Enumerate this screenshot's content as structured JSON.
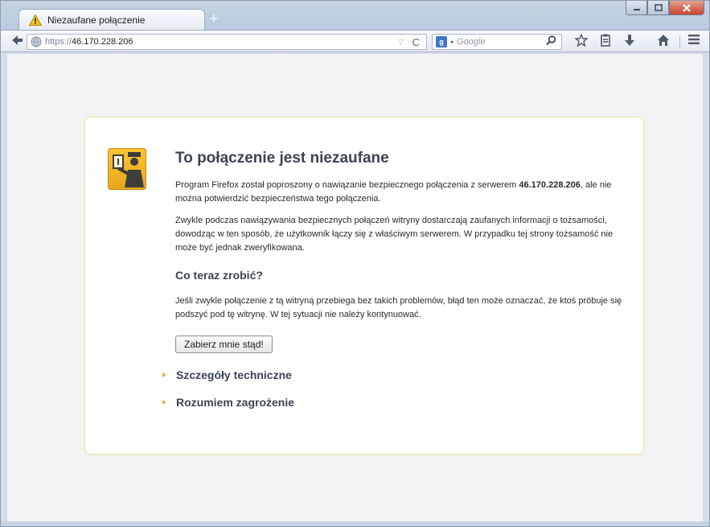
{
  "browser": {
    "tab_title": "Niezaufane połączenie",
    "new_tab_symbol": "+",
    "url_protocol": "https://",
    "url_host": "46.170.228.206",
    "search_placeholder": "Google",
    "window_controls": [
      "minimize",
      "maximize",
      "close"
    ]
  },
  "icons": {
    "tab": "warning-icon",
    "back": "back-arrow-icon",
    "site": "globe-icon",
    "reload": "reload-icon",
    "search_engine": "google-icon",
    "search_go": "magnifier-icon",
    "bookmark": "star-icon",
    "library": "clipboard-icon",
    "downloads": "download-arrow-icon",
    "home": "home-icon",
    "menu": "hamburger-menu-icon",
    "page": "certificate-officer-icon"
  },
  "error_page": {
    "title": "To połączenie jest niezaufane",
    "intro_prefix": "Program Firefox został poproszony o nawiązanie bezpiecznego połączenia z serwerem ",
    "intro_host": "46.170.228.206",
    "intro_suffix": ", ale nie można potwierdzić bezpieczeństwa tego połączenia.",
    "explanation": "Zwykle podczas nawiązywania bezpiecznych połączeń witryny dostarczają zaufanych informacji o tożsamości, dowodząc w ten sposób, że użytkownik łączy się z właściwym serwerem. W przypadku tej strony tożsamość nie może być jednak zweryfikowana.",
    "what_to_do_title": "Co teraz zrobić?",
    "what_to_do_text": "Jeśli zwykle połączenie z tą witryną przebiega bez takich problemów, błąd ten może oznaczać, że ktoś próbuje się podszyć pod tę witrynę. W tej sytuacji nie należy kontynuować.",
    "get_me_out_button": "Zabierz mnie stąd!",
    "technical_details": "Szczegóły techniczne",
    "understand_risks": "Rozumiem zagrożenie"
  },
  "colors": {
    "card_border": "#f0e3a0",
    "heading": "#3b4451",
    "expander_arrow": "#e3b24a",
    "icon_yellow": "#f9c634"
  }
}
